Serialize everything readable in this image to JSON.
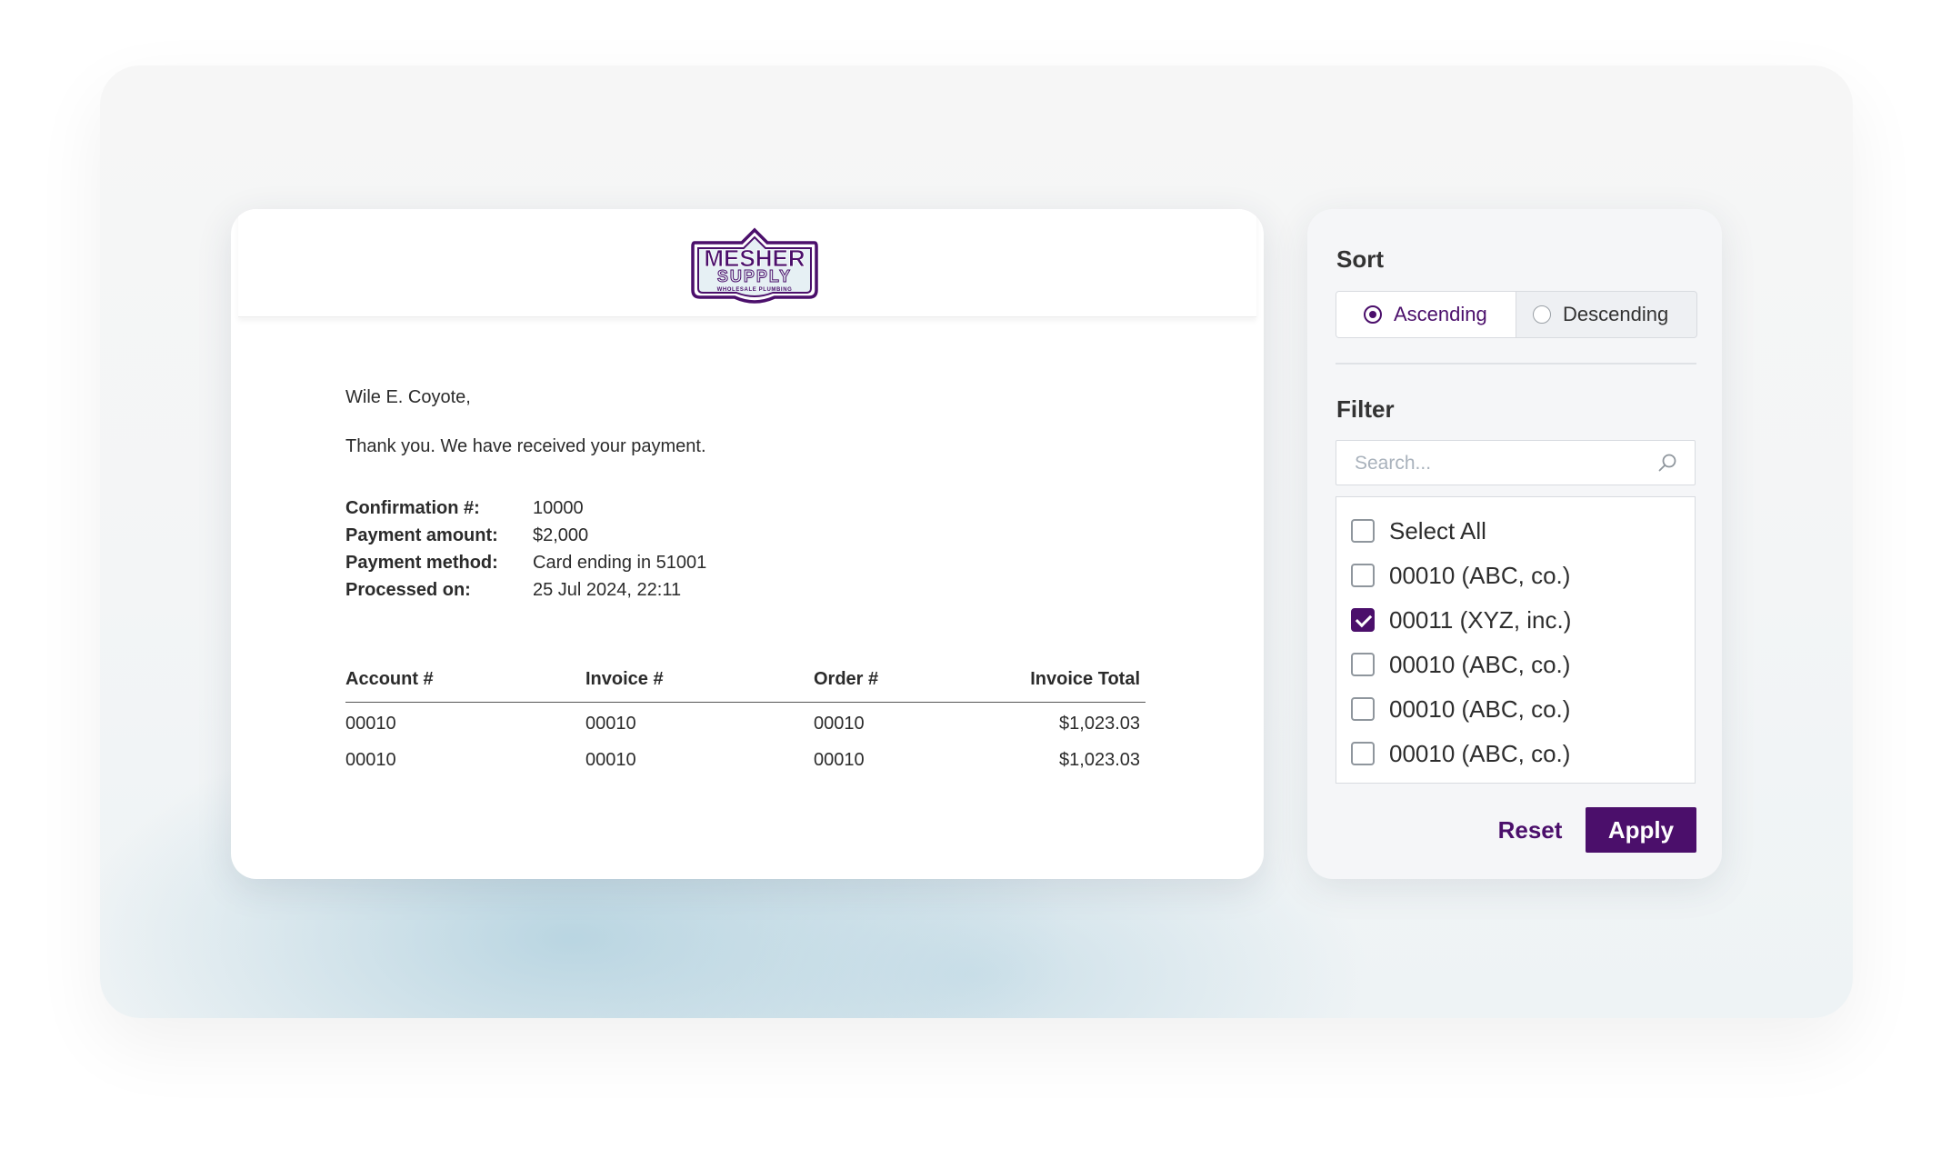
{
  "colors": {
    "brand": "#4b0f6b",
    "panel_bg": "#f5f6f8",
    "card_bg": "#ffffff",
    "backdrop_tint": "#b0d0de"
  },
  "email": {
    "logo": {
      "name": "MESHER",
      "sub": "SUPPLY",
      "tagline": "WHOLESALE PLUMBING"
    },
    "greeting": "Wile E. Coyote,",
    "message": "Thank you. We have received your payment.",
    "details": [
      {
        "label": "Confirmation #:",
        "value": "10000"
      },
      {
        "label": "Payment amount:",
        "value": "$2,000"
      },
      {
        "label": "Payment method:",
        "value": "Card ending in 51001"
      },
      {
        "label": "Processed on:",
        "value": "25 Jul 2024, 22:11"
      }
    ],
    "table": {
      "headers": [
        "Account #",
        "Invoice #",
        "Order #",
        "Invoice Total"
      ],
      "rows": [
        [
          "00010",
          "00010",
          "00010",
          "$1,023.03"
        ],
        [
          "00010",
          "00010",
          "00010",
          "$1,023.03"
        ]
      ]
    }
  },
  "panel": {
    "sort": {
      "title": "Sort",
      "options": [
        {
          "label": "Ascending",
          "selected": true
        },
        {
          "label": "Descending",
          "selected": false
        }
      ]
    },
    "filter": {
      "title": "Filter",
      "search_placeholder": "Search...",
      "search_icon": "search-icon",
      "items": [
        {
          "label": "Select All",
          "checked": false
        },
        {
          "label": "00010 (ABC, co.)",
          "checked": false
        },
        {
          "label": "00011 (XYZ, inc.)",
          "checked": true
        },
        {
          "label": "00010 (ABC, co.)",
          "checked": false
        },
        {
          "label": "00010 (ABC, co.)",
          "checked": false
        },
        {
          "label": "00010 (ABC, co.)",
          "checked": false
        }
      ]
    },
    "reset_label": "Reset",
    "apply_label": "Apply"
  }
}
